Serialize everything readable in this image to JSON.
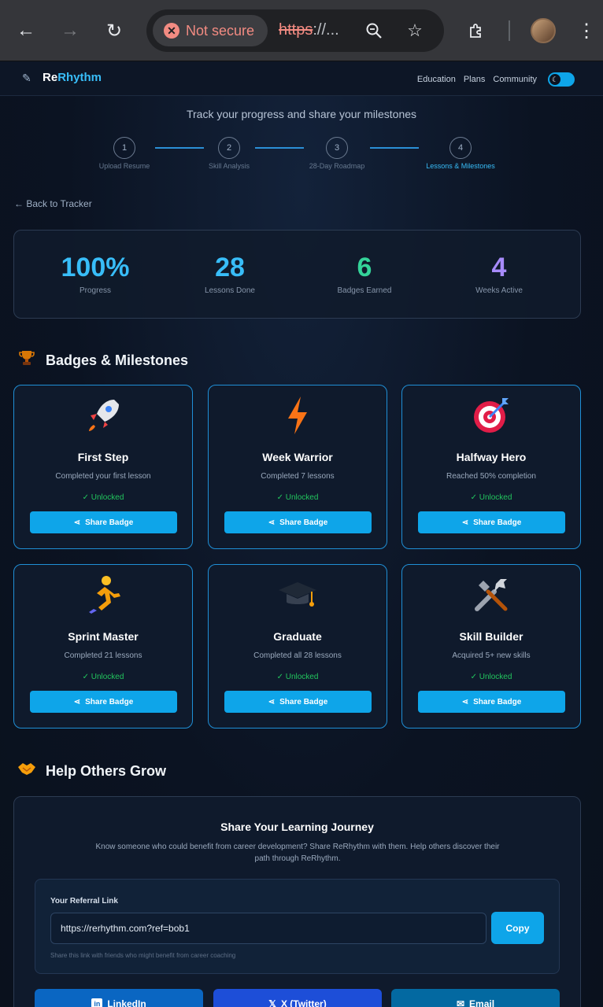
{
  "browser": {
    "security_label": "Not secure",
    "url_scheme": "https",
    "url_rest": "://..."
  },
  "nav": {
    "brand_prefix": "Re",
    "brand_suffix": "Rhythm",
    "links": [
      "Education",
      "Plans",
      "Community"
    ]
  },
  "page": {
    "subtitle": "Track your progress and share your milestones",
    "back_link": "← Back to Tracker"
  },
  "steps": [
    {
      "num": "1",
      "label": "Upload Resume"
    },
    {
      "num": "2",
      "label": "Skill Analysis"
    },
    {
      "num": "3",
      "label": "28-Day Roadmap"
    },
    {
      "num": "4",
      "label": "Lessons & Milestones"
    }
  ],
  "stats": [
    {
      "value": "100%",
      "label": "Progress",
      "color": "#38bdf8"
    },
    {
      "value": "28",
      "label": "Lessons Done",
      "color": "#38bdf8"
    },
    {
      "value": "6",
      "label": "Badges Earned",
      "color": "#34d399"
    },
    {
      "value": "4",
      "label": "Weeks Active",
      "color": "#a78bfa"
    }
  ],
  "badges_section": {
    "title": "Badges & Milestones"
  },
  "badges": [
    {
      "title": "First Step",
      "desc": "Completed your first lesson",
      "status": "Unlocked",
      "share": "Share Badge",
      "icon": "rocket-icon"
    },
    {
      "title": "Week Warrior",
      "desc": "Completed 7 lessons",
      "status": "Unlocked",
      "share": "Share Badge",
      "icon": "lightning-icon"
    },
    {
      "title": "Halfway Hero",
      "desc": "Reached 50% completion",
      "status": "Unlocked",
      "share": "Share Badge",
      "icon": "target-icon"
    },
    {
      "title": "Sprint Master",
      "desc": "Completed 21 lessons",
      "status": "Unlocked",
      "share": "Share Badge",
      "icon": "runner-icon"
    },
    {
      "title": "Graduate",
      "desc": "Completed all 28 lessons",
      "status": "Unlocked",
      "share": "Share Badge",
      "icon": "graduation-cap-icon"
    },
    {
      "title": "Skill Builder",
      "desc": "Acquired 5+ new skills",
      "status": "Unlocked",
      "share": "Share Badge",
      "icon": "tools-icon"
    }
  ],
  "help_section": {
    "title": "Help Others Grow"
  },
  "share": {
    "title": "Share Your Learning Journey",
    "desc": "Know someone who could benefit from career development? Share ReRhythm with them. Help others discover their path through ReRhythm.",
    "ref_label": "Your Referral Link",
    "ref_value": "https://rerhythm.com?ref=bob1",
    "copy_label": "Copy",
    "hint": "Share this link with friends who might benefit from career coaching",
    "buttons": [
      {
        "label": "LinkedIn",
        "color": "#0a66c2"
      },
      {
        "label": "X (Twitter)",
        "color": "#1d4ed8"
      },
      {
        "label": "Email",
        "color": "#0369a1"
      }
    ]
  }
}
